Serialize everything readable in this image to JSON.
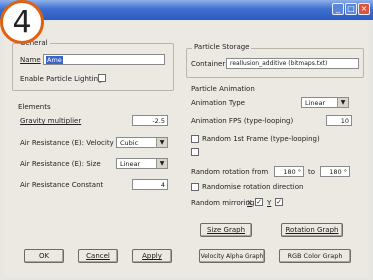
{
  "badge": {
    "number": "4"
  },
  "titlebar": {
    "minimize": "_",
    "maximize": "□",
    "close": "×"
  },
  "left": {
    "general": {
      "legend": "General",
      "name_label": "Name",
      "name_value": "Ame",
      "lighting_label": "Enable Particle Lighting"
    },
    "elements": {
      "legend": "Elements",
      "gravity_label": "Gravity multiplier",
      "gravity_value": "-2.5",
      "air_velocity_label": "Air Resistance (E): Velocity",
      "air_velocity_value": "Cubic",
      "air_size_label": "Air Resistance (E): Size",
      "air_size_value": "Linear",
      "air_constant_label": "Air Resistance Constant",
      "air_constant_value": "4"
    }
  },
  "right": {
    "storage": {
      "legend": "Particle Storage",
      "container_label": "Container",
      "container_value": "reallusion_additive (bitmaps.txt)"
    },
    "animation": {
      "legend": "Particle Animation",
      "type_label": "Animation Type",
      "type_value": "Linear",
      "fps_label": "Animation FPS (type-looping)",
      "fps_value": "10",
      "random_first_frame_label": "Random 1st Frame (type-looping)",
      "rotation_label": "Random rotation from",
      "rotation_from": "180 °",
      "rotation_to_label": "to",
      "rotation_to": "180 °",
      "randomise_direction_label": "Randomise rotation direction",
      "mirroring_label": "Random mirroring",
      "mirror_x": "X",
      "mirror_y": "Y"
    }
  },
  "buttons": {
    "ok": "OK",
    "cancel": "Cancel",
    "apply": "Apply",
    "size_graph": "Size Graph",
    "rotation_graph": "Rotation Graph",
    "velocity_alpha_graph": "Velocity Alpha Graph",
    "rgb_color_graph": "RGB Color Graph"
  },
  "colors": {
    "accent_badge": "#e06010",
    "titlebar": "#2c5bc0"
  }
}
